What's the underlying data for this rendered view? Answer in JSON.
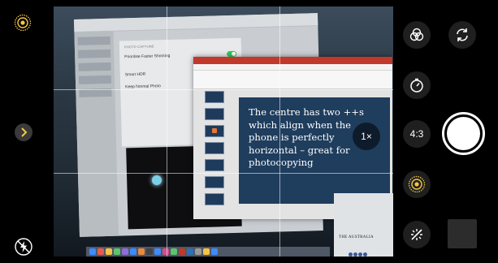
{
  "camera": {
    "zoom_label": "1×",
    "aspect_ratio_label": "4:3",
    "icons": {
      "live_photo": "live-photo-icon",
      "expand": "chevron-right-icon",
      "flash": "flash-off-icon",
      "filters": "filters-icon",
      "flip": "flip-camera-icon",
      "timer": "timer-icon",
      "live_toggle": "live-photo-icon",
      "night_mode": "night-mode-off-icon"
    },
    "accent_color": "#f3c744"
  },
  "viewfinder": {
    "settings_panel": {
      "section_title": "PHOTO CAPTURE",
      "options": [
        {
          "label": "Prioritise Faster Shooting",
          "on": true
        },
        {
          "label": "Smart HDR",
          "on": true
        },
        {
          "label": "Keep Normal Photo",
          "on": false
        }
      ]
    },
    "slide": {
      "text": "The centre has two ++s which align when the phone is perfectly horizontal – great for photocopying"
    },
    "newspaper": {
      "headline": "THE AUSTRALIA"
    }
  }
}
